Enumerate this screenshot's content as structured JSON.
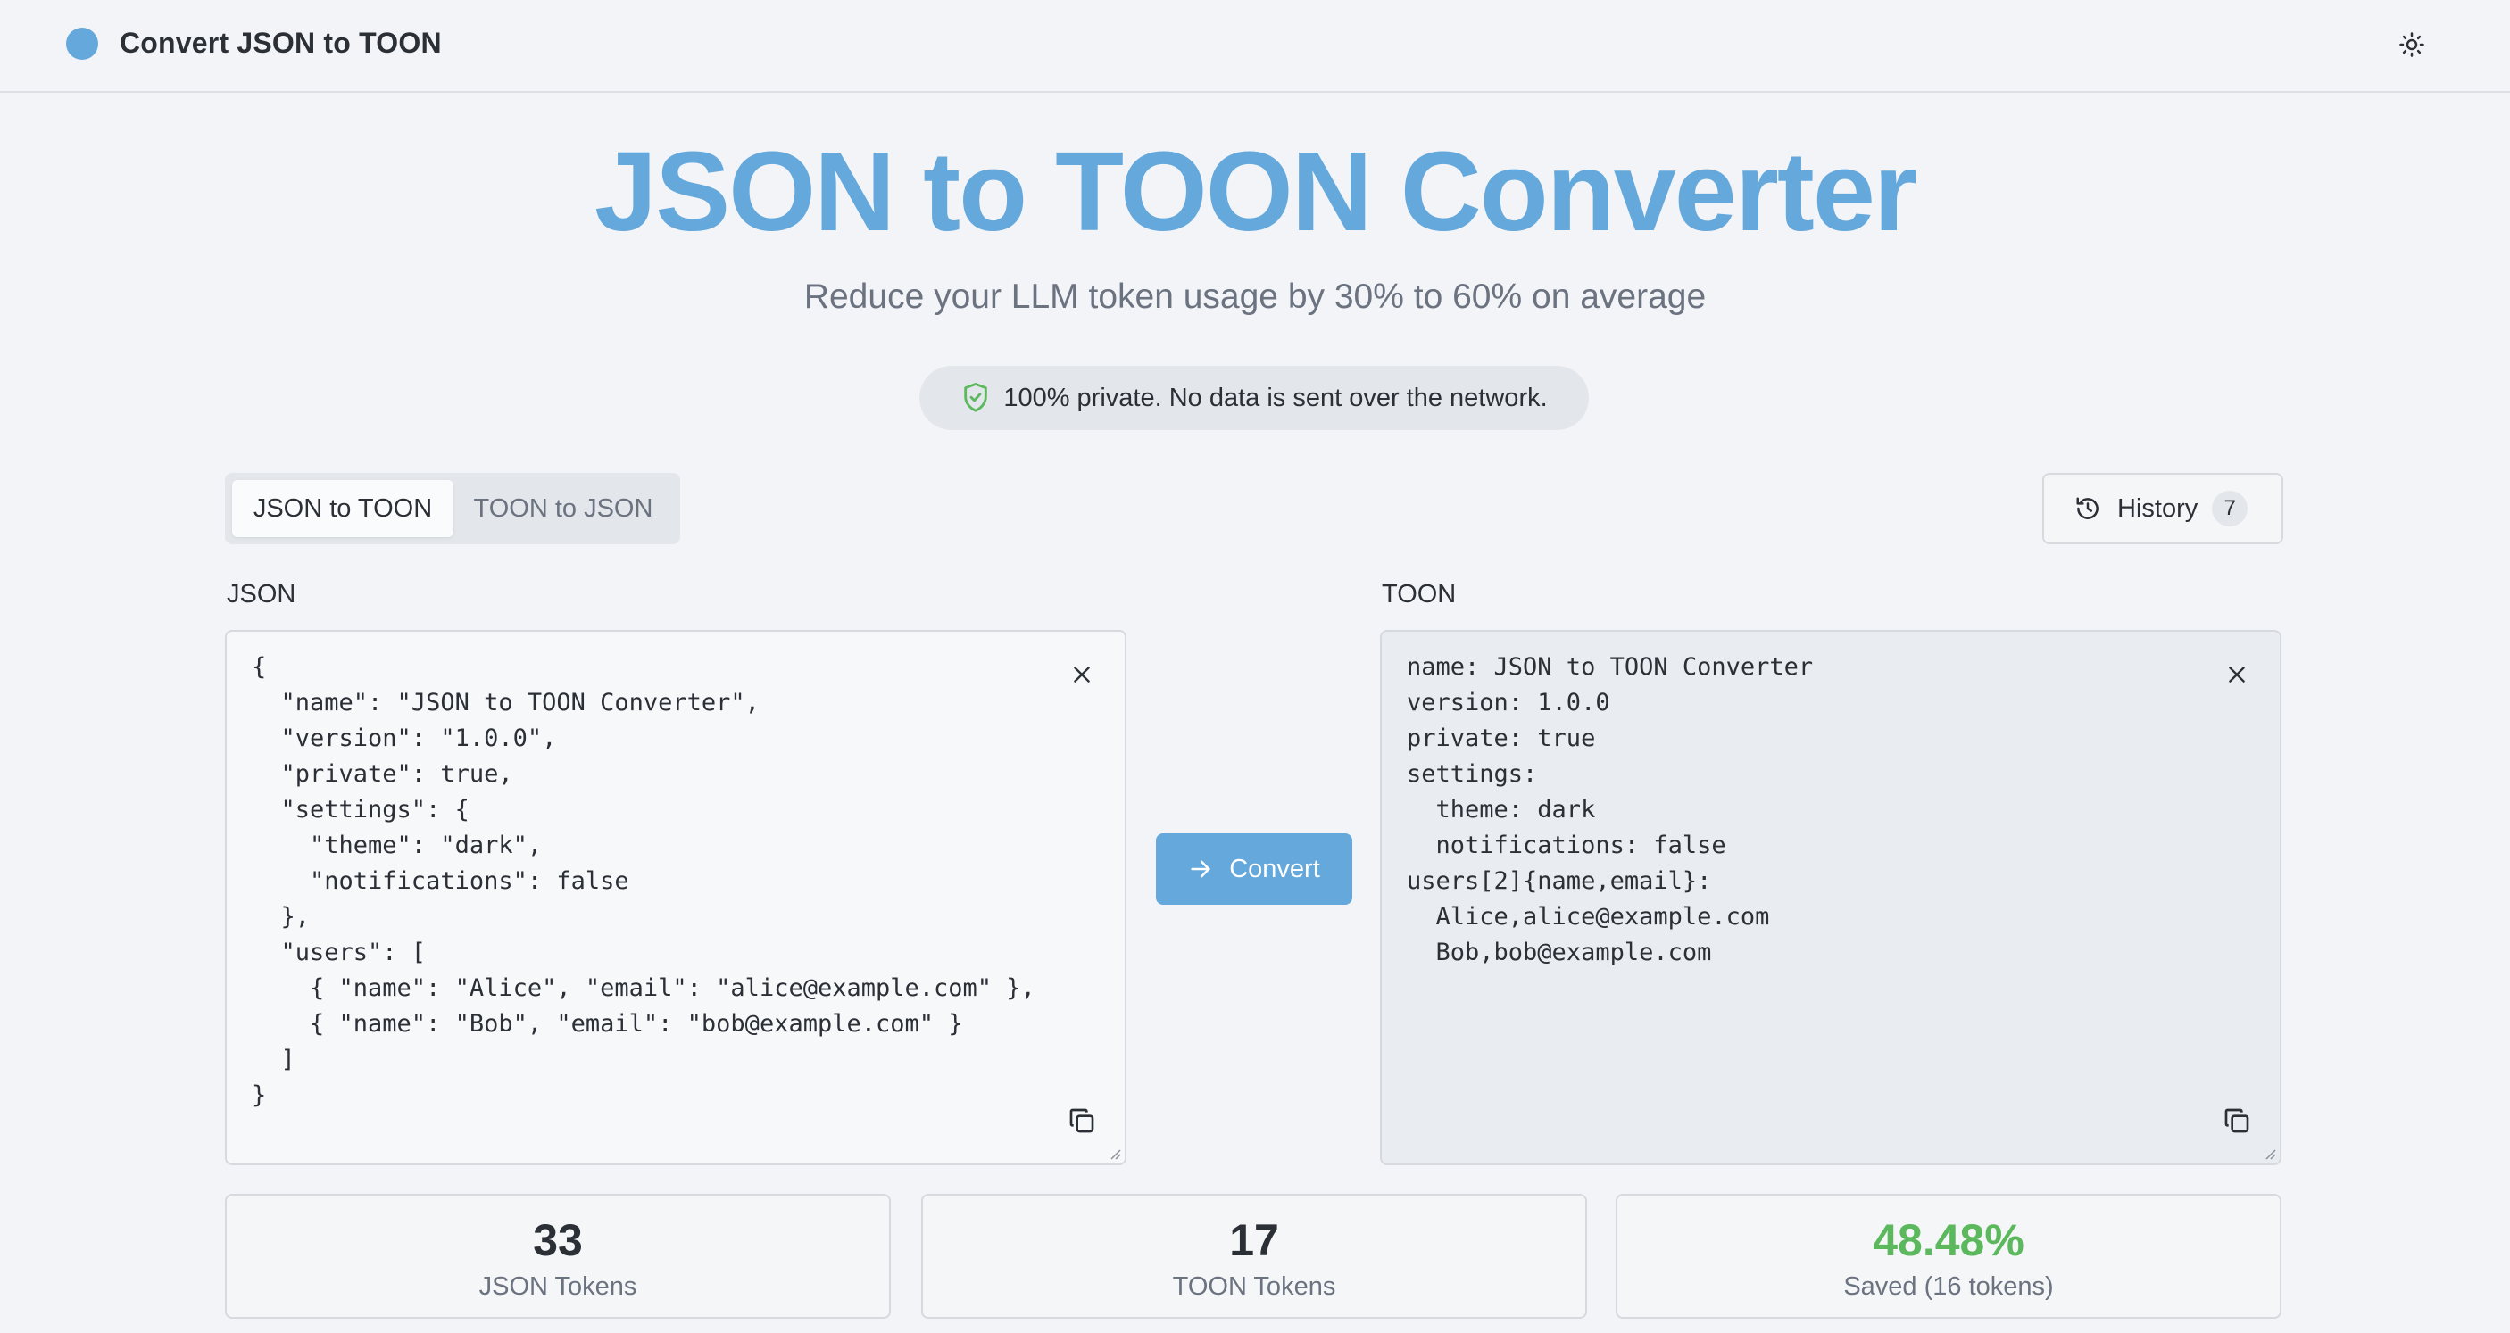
{
  "header": {
    "brand_name": "Convert JSON to TOON",
    "brand_color": "#64a8dc",
    "theme_toggle_icon": "sun-icon"
  },
  "hero": {
    "title": "JSON to TOON Converter",
    "subtitle": "Reduce your LLM token usage by 30% to 60% on average",
    "privacy_text": "100% private. No data is sent over the network.",
    "privacy_icon": "shield-check-icon"
  },
  "mode_tabs": [
    {
      "label": "JSON to TOON",
      "active": true
    },
    {
      "label": "TOON to JSON",
      "active": false
    }
  ],
  "history": {
    "label": "History",
    "count": "7",
    "icon": "history-icon"
  },
  "input_panel": {
    "label": "JSON",
    "content": "{\n  \"name\": \"JSON to TOON Converter\",\n  \"version\": \"1.0.0\",\n  \"private\": true,\n  \"settings\": {\n    \"theme\": \"dark\",\n    \"notifications\": false\n  },\n  \"users\": [\n    { \"name\": \"Alice\", \"email\": \"alice@example.com\" },\n    { \"name\": \"Bob\", \"email\": \"bob@example.com\" }\n  ]\n}"
  },
  "output_panel": {
    "label": "TOON",
    "content": "name: JSON to TOON Converter\nversion: 1.0.0\nprivate: true\nsettings:\n  theme: dark\n  notifications: false\nusers[2]{name,email}:\n  Alice,alice@example.com\n  Bob,bob@example.com"
  },
  "convert_button": {
    "label": "Convert",
    "icon": "arrow-right-icon"
  },
  "stats": {
    "json_tokens": {
      "value": "33",
      "label": "JSON Tokens"
    },
    "toon_tokens": {
      "value": "17",
      "label": "TOON Tokens"
    },
    "saved": {
      "value": "48.48%",
      "label": "Saved (16 tokens)",
      "color": "#5cb85c"
    }
  }
}
